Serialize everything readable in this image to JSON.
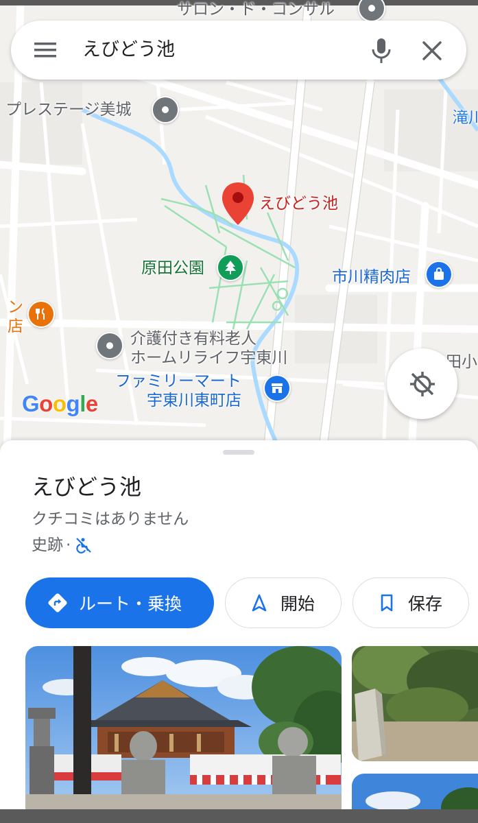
{
  "search": {
    "query": "えびどう池",
    "menu_icon": "hamburger-menu-icon",
    "mic_icon": "microphone-icon",
    "close_icon": "close-icon"
  },
  "map": {
    "labels": {
      "top_cut": "サロン・ド・コンサル",
      "prestage": "プレステージ美城",
      "pin_label": "えびどう池",
      "park": "原田公園",
      "meat_shop": "市川精肉店",
      "restaurant_line1": "ン",
      "restaurant_line2": "店",
      "nursing_line1": "介護付き有料老人",
      "nursing_line2": "ホームリライフ宇東川",
      "familymart_line1": "ファミリーマート",
      "familymart_line2": "宇東川東町店",
      "right_cut": "田小",
      "right_top": "滝川"
    },
    "logo": {
      "G": "G",
      "o1": "o",
      "o2": "o",
      "g": "g",
      "l": "l",
      "e": "e"
    },
    "colors": {
      "pin": "#ea4335",
      "park": "#0f9d58",
      "shop": "#1a73e8",
      "food": "#e8710a",
      "generic_poi": "#70757a",
      "water": "#aadaff",
      "road": "#ffffff",
      "park_path": "#9be0b3"
    }
  },
  "place": {
    "title": "えびどう池",
    "reviews": "クチコミはありません",
    "category": "史跡",
    "separator": "·",
    "accessibility_icon": "not-wheelchair-accessible-icon"
  },
  "actions": {
    "route_label": "ルート・乗換",
    "start_label": "開始",
    "save_label": "保存"
  },
  "accent": "#1a73e8"
}
